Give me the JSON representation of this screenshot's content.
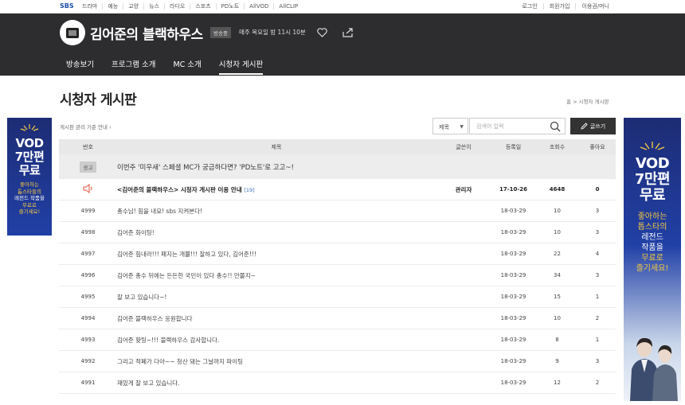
{
  "gnb": {
    "logo": "SBS",
    "links": [
      "드라마",
      "예능",
      "교양",
      "뉴스",
      "라디오",
      "스포츠",
      "PD노트",
      "AllVOD",
      "AllCLIP"
    ],
    "right": [
      "로그인",
      "회원가입",
      "이용권/머니"
    ]
  },
  "program": {
    "title": "김어준의 블랙하우스",
    "onair": "방송중",
    "schedule": "매주 목요일 밤 11시 10분",
    "menu": [
      "방송보기",
      "프로그램 소개",
      "MC 소개",
      "시청자 게시판"
    ],
    "active_menu": "시청자 게시판"
  },
  "page": {
    "title": "시청자 게시판",
    "breadcrumb_home": "홈",
    "breadcrumb_sep": ">",
    "breadcrumb_current": "시청자 게시판",
    "notice_link": "게시판 관리 기준 안내 ›"
  },
  "controls": {
    "select_value": "제목",
    "search_placeholder": "검색어 입력",
    "write_label": "글쓰기"
  },
  "table": {
    "headers": [
      "번호",
      "제목",
      "글쓴이",
      "등록일",
      "조회수",
      "좋아요"
    ],
    "ad": {
      "tag": "광고",
      "title": "이번주 '미우새' 스페셜 MC가 궁금하다면? 'PD노트'로 고고~!"
    },
    "notice": {
      "title": "<김어준의 블랙하우스> 시청자 게시판 이용 안내",
      "count": "[19]",
      "author": "관리자",
      "date": "17-10-26",
      "views": "4648",
      "likes": "0"
    },
    "rows": [
      {
        "no": "4999",
        "title": "총수님! 힘을 내요! sbs 지켜본다!",
        "date": "18-03-29",
        "views": "10",
        "likes": "3"
      },
      {
        "no": "4998",
        "title": "김어준 화이팅!",
        "date": "18-03-29",
        "views": "10",
        "likes": "3"
      },
      {
        "no": "4997",
        "title": "김어준 힘내라!!! 패지는 개쁠!!! 잘하고 있다, 김어준!!!",
        "date": "18-03-29",
        "views": "22",
        "likes": "4"
      },
      {
        "no": "4996",
        "title": "김어준 총수 뒤에는 든든한 국민이 있다 총수!! 안쫄지~",
        "date": "18-03-29",
        "views": "34",
        "likes": "3"
      },
      {
        "no": "4995",
        "title": "잘 보고 있습니다~!",
        "date": "18-03-29",
        "views": "15",
        "likes": "1"
      },
      {
        "no": "4994",
        "title": "김어준 블랙하우스 응원합니다",
        "date": "18-03-29",
        "views": "10",
        "likes": "2"
      },
      {
        "no": "4993",
        "title": "김어준 홧팅~!!! 블랙하우스 감사합니다.",
        "date": "18-03-29",
        "views": "8",
        "likes": "1"
      },
      {
        "no": "4992",
        "title": "그리고 적폐가 다아~~ 청산 돼는 그날까지 파이팅",
        "date": "18-03-29",
        "views": "9",
        "likes": "3"
      },
      {
        "no": "4991",
        "title": "재밌게 잘 보고 있습니다.",
        "date": "18-03-29",
        "views": "12",
        "likes": "2"
      }
    ]
  },
  "banners": {
    "vod_line1": "VOD",
    "vod_line2": "7만편",
    "vod_line3": "무료",
    "left_sub1": "좋아하는",
    "left_sub2": "톱스타들의",
    "left_sub3": "레전드 작품을",
    "left_sub4": "무료로",
    "left_sub5": "즐기세요!",
    "right_sub1": "좋아하는",
    "right_sub2": "톱스타의",
    "right_sub3": "레전드",
    "right_sub4": "작품을",
    "right_sub5": "무료로",
    "right_sub6": "즐기세요!"
  },
  "colors": {
    "header_bg": "#2d2d30",
    "banner_blue": "#2140a6",
    "accent_yellow": "#f5c842",
    "notice_count": "#3a6cc7",
    "speaker_icon": "#e0533c"
  }
}
